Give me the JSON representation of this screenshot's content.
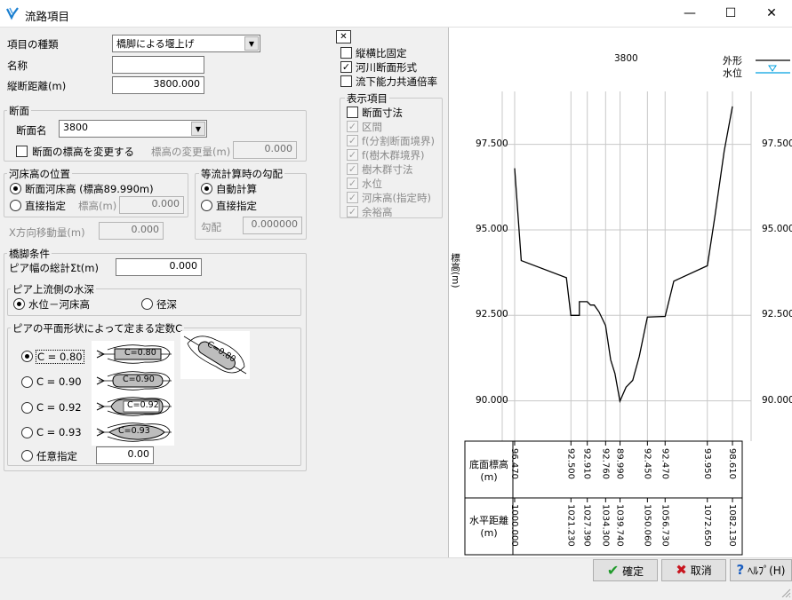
{
  "window": {
    "title": "流路項目",
    "minimize": "—",
    "maximize": "☐",
    "close": "✕"
  },
  "item": {
    "type_label": "項目の種類",
    "type_value": "橋脚による堰上げ",
    "name_label": "名称",
    "name_value": "",
    "dist_label": "縦断距離(m)",
    "dist_value": "3800.000"
  },
  "section": {
    "group_title": "断面",
    "name_label": "断面名",
    "name_value": "3800",
    "change_elev_label": "断面の標高を変更する",
    "change_amount_label": "標高の変更量(m)",
    "change_amount_value": "0.000"
  },
  "bed": {
    "group_title": "河床高の位置",
    "opt1": "断面河床高 (標高89.990m)",
    "opt2": "直接指定",
    "elev_label": "標高(m)",
    "elev_value": "0.000",
    "xshift_label": "X方向移動量(m)",
    "xshift_value": "0.000"
  },
  "slope": {
    "group_title": "等流計算時の勾配",
    "opt1": "自動計算",
    "opt2": "直接指定",
    "slope_label": "勾配",
    "slope_value": "0.000000"
  },
  "pier": {
    "group_title": "橋脚条件",
    "width_label": "ピア幅の総計Σt(m)",
    "width_value": "0.000",
    "depth_group": "ピア上流側の水深",
    "depth_opt1": "水位－河床高",
    "depth_opt2": "径深",
    "c_group": "ピアの平面形状によって定まる定数C",
    "c_opt1": "C = 0.80",
    "c_opt2": "C = 0.90",
    "c_opt3": "C = 0.92",
    "c_opt4": "C = 0.93",
    "c_opt5": "任意指定",
    "c_custom_value": "0.00",
    "img_c1": "C=0.80",
    "img_c2": "C=0.90",
    "img_c3": "C=0.92",
    "img_c4": "C=0.93",
    "img_c5": "C=0.80"
  },
  "options": {
    "close_x": "✕",
    "aspect_fixed": "縦横比固定",
    "river_section": "河川断面形式",
    "flow_common": "流下能力共通倍率"
  },
  "display": {
    "group_title": "表示項目",
    "i1": "断面寸法",
    "i2": "区間",
    "i3": "f(分割断面境界)",
    "i4": "f(樹木群境界)",
    "i5": "樹木群寸法",
    "i6": "水位",
    "i7": "河床高(指定時)",
    "i8": "余裕高"
  },
  "buttons": {
    "ok": "確定",
    "cancel": "取消",
    "help": "ﾍﾙﾌﾟ(H)"
  },
  "chart_data": {
    "type": "line",
    "title": "3800",
    "ylabel": "標高(m)",
    "legend": [
      {
        "name": "外形",
        "color": "#000000"
      },
      {
        "name": "水位",
        "color": "#00a0e0"
      }
    ],
    "ylim": [
      88.9,
      99.1
    ],
    "xlim": [
      998.0,
      1085.8
    ],
    "yticks": [
      "97.500",
      "95.000",
      "92.500",
      "90.000"
    ],
    "ytick_values": [
      97.5,
      95.0,
      92.5,
      90.0
    ],
    "profile": [
      [
        1000.0,
        96.8
      ],
      [
        1002.5,
        94.1
      ],
      [
        1019.5,
        93.6
      ],
      [
        1021.2,
        92.5
      ],
      [
        1024.4,
        92.5
      ],
      [
        1024.4,
        92.9
      ],
      [
        1027.4,
        92.9
      ],
      [
        1028.6,
        92.8
      ],
      [
        1030.0,
        92.8
      ],
      [
        1031.8,
        92.6
      ],
      [
        1034.3,
        92.2
      ],
      [
        1036.2,
        91.2
      ],
      [
        1037.8,
        90.8
      ],
      [
        1039.7,
        89.99
      ],
      [
        1042.0,
        90.4
      ],
      [
        1044.5,
        90.6
      ],
      [
        1047.0,
        91.3
      ],
      [
        1050.06,
        92.45
      ],
      [
        1056.73,
        92.47
      ],
      [
        1060.0,
        93.5
      ],
      [
        1072.65,
        93.95
      ],
      [
        1075.5,
        95.4
      ],
      [
        1079.0,
        97.3
      ],
      [
        1082.13,
        98.61
      ]
    ],
    "gridlines_x": [
      1000.0,
      1021.23,
      1027.39,
      1034.3,
      1039.74,
      1050.06,
      1056.73,
      1072.65,
      1082.13
    ],
    "table": {
      "row1_label": "底面標高\n(m)",
      "row2_label": "水平距離\n(m)",
      "columns": [
        {
          "elev": "96.470",
          "dist": "1000.000"
        },
        {
          "elev": "92.500",
          "dist": "1021.230"
        },
        {
          "elev": "92.910",
          "dist": "1027.390"
        },
        {
          "elev": "92.760",
          "dist": "1034.300"
        },
        {
          "elev": "89.990",
          "dist": "1039.740"
        },
        {
          "elev": "92.450",
          "dist": "1050.060"
        },
        {
          "elev": "92.470",
          "dist": "1056.730"
        },
        {
          "elev": "93.950",
          "dist": "1072.650"
        },
        {
          "elev": "98.610",
          "dist": "1082.130"
        }
      ]
    }
  }
}
